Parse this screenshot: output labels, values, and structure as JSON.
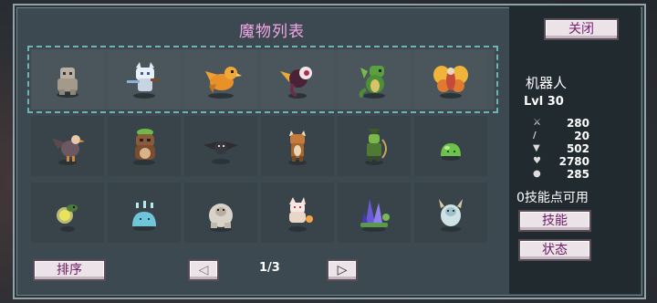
{
  "window": {
    "title": "魔物列表",
    "close_label": "关闭"
  },
  "team_row": [
    {
      "icon": "stone-golem-icon"
    },
    {
      "icon": "white-cat-swordsman-icon"
    },
    {
      "icon": "orange-griffin-icon"
    },
    {
      "icon": "eye-bat-icon"
    },
    {
      "icon": "green-lizard-dragon-icon"
    },
    {
      "icon": "fire-moth-icon"
    }
  ],
  "grid_rows": [
    [
      {
        "icon": "vulture-icon"
      },
      {
        "icon": "leaf-tanuki-icon"
      },
      {
        "icon": "shadow-crow-icon"
      },
      {
        "icon": "horned-beast-icon"
      },
      {
        "icon": "goblin-archer-icon"
      },
      {
        "icon": "green-slime-icon"
      }
    ],
    [
      {
        "icon": "firefly-icon"
      },
      {
        "icon": "water-slime-icon"
      },
      {
        "icon": "white-ape-icon"
      },
      {
        "icon": "fox-spirit-icon"
      },
      {
        "icon": "crystal-snail-icon"
      },
      {
        "icon": "frost-yeti-icon"
      }
    ]
  ],
  "footer": {
    "sort_label": "排序",
    "prev_label": "◁",
    "page_indicator": "1/3",
    "next_label": "▷"
  },
  "details": {
    "name": "机器人",
    "level": "Lvl 30",
    "stats": [
      {
        "icon": "sword-icon",
        "value": "280"
      },
      {
        "icon": "staff-icon",
        "value": "20"
      },
      {
        "icon": "shield-icon",
        "value": "502"
      },
      {
        "icon": "heart-icon",
        "value": "2780"
      },
      {
        "icon": "speed-icon",
        "value": "285"
      }
    ],
    "skill_points": "0技能点可用",
    "skill_label": "技能",
    "status_label": "状态"
  },
  "colors": {
    "title": "#f2a6e6",
    "panel": "#3d4951",
    "accent_border": "#6fb3b5"
  }
}
